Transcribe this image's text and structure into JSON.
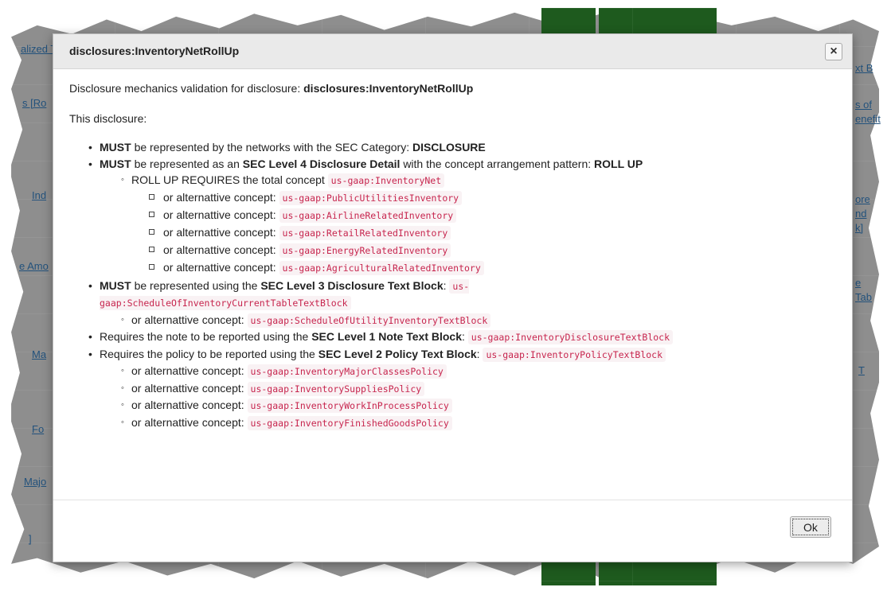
{
  "background_links": {
    "l1": "alized T",
    "l2": "s [Ro",
    "l3": "Ind",
    "l4": "e Amo",
    "l5": "Ma",
    "l6": "Fo",
    "l7": "Majo",
    "l8": "]",
    "r1": "xt B",
    "r2": "s of",
    "r3": "enefit",
    "r4": "ore",
    "r5": "nd",
    "r6": "k]",
    "r7": "e",
    "r8": "Tab",
    "r9": "T"
  },
  "dialog": {
    "title": "disclosures:InventoryNetRollUp",
    "close_icon": "×",
    "intro_prefix": "Disclosure mechanics validation for disclosure:",
    "intro_name": "disclosures:InventoryNetRollUp",
    "this_disclosure": "This disclosure:",
    "b1": {
      "must": "MUST",
      "text": "be represented by the networks with the SEC Category:",
      "category": "DISCLOSURE"
    },
    "b2": {
      "must": "MUST",
      "text1": "be represented as an",
      "level": "SEC Level 4 Disclosure Detail",
      "text2": "with the concept arrangement pattern:",
      "pattern": "ROLL UP",
      "sub_text": "ROLL UP REQUIRES the total concept",
      "sub_code": "us-gaap:InventoryNet",
      "alt_label": "or alternattive concept:",
      "alternatives": [
        "us-gaap:PublicUtilitiesInventory",
        "us-gaap:AirlineRelatedInventory",
        "us-gaap:RetailRelatedInventory",
        "us-gaap:EnergyRelatedInventory",
        "us-gaap:AgriculturalRelatedInventory"
      ]
    },
    "b3": {
      "must": "MUST",
      "text": "be represented using the",
      "level": "SEC Level 3 Disclosure Text Block",
      "code": "us-gaap:ScheduleOfInventoryCurrentTableTextBlock",
      "alt_label": "or alternattive concept:",
      "alt_code": "us-gaap:ScheduleOfUtilityInventoryTextBlock"
    },
    "b4": {
      "text": "Requires the note to be reported using the",
      "level": "SEC Level 1 Note Text Block",
      "code": "us-gaap:InventoryDisclosureTextBlock"
    },
    "b5": {
      "text": "Requires the policy to be reported using the",
      "level": "SEC Level 2 Policy Text Block",
      "code": "us-gaap:InventoryPolicyTextBlock",
      "alt_label": "or alternattive concept:",
      "alternatives": [
        "us-gaap:InventoryMajorClassesPolicy",
        "us-gaap:InventorySuppliesPolicy",
        "us-gaap:InventoryWorkInProcessPolicy",
        "us-gaap:InventoryFinishedGoodsPolicy"
      ]
    },
    "ok_label": "Ok"
  }
}
